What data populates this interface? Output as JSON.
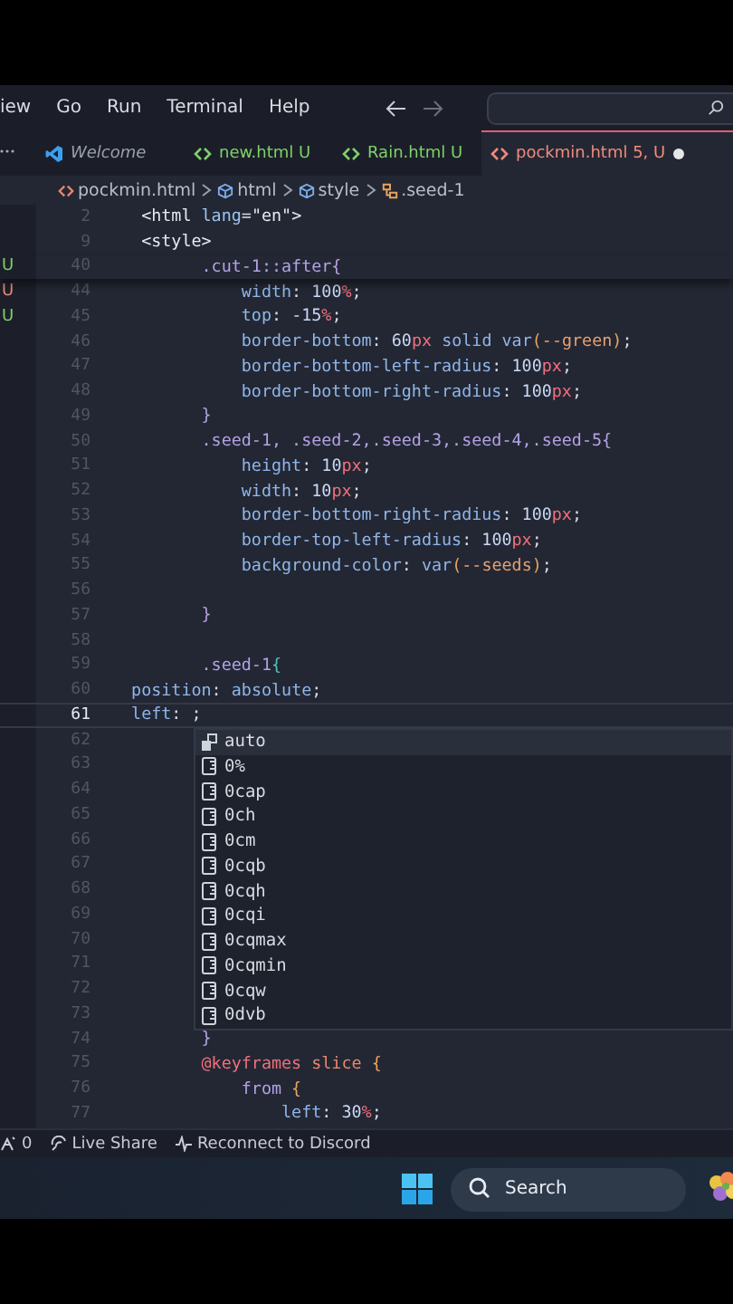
{
  "menu_bar": {
    "items": [
      "iew",
      "Go",
      "Run",
      "Terminal",
      "Help"
    ]
  },
  "tabs": [
    {
      "label": "Welcome",
      "kind": "welcome",
      "color": "#9aa0ad",
      "selected": false
    },
    {
      "label": "new.html",
      "status": "U",
      "kind": "html",
      "color": "#7fd16b",
      "selected": false
    },
    {
      "label": "Rain.html",
      "status": "U",
      "kind": "html",
      "color": "#7fd16b",
      "selected": false
    },
    {
      "label": "pockmin.html",
      "status": "5, U",
      "kind": "html",
      "color": "#f08b7e",
      "selected": true,
      "modified": true
    }
  ],
  "breadcrumb": [
    {
      "label": "pockmin.html",
      "kind": "file"
    },
    {
      "label": "html",
      "kind": "element"
    },
    {
      "label": "style",
      "kind": "element"
    },
    {
      "label": ".seed-1",
      "kind": "rule"
    }
  ],
  "editor": {
    "lines": [
      {
        "number": "2",
        "tokens": [
          {
            "kind": "tag",
            "text": "  <html"
          },
          {
            "kind": "attr",
            "text": " lang"
          },
          {
            "kind": "punct",
            "text": "="
          },
          {
            "kind": "str",
            "text": "\"en\""
          },
          {
            "kind": "tag",
            "text": ">"
          }
        ]
      },
      {
        "number": "9",
        "tokens": [
          {
            "kind": "tag",
            "text": "  <style>"
          }
        ]
      },
      {
        "number": "40",
        "sticky_end": true,
        "side_mark": {
          "text": "U",
          "color": "#7fd16b"
        },
        "tokens": [
          {
            "kind": "sel",
            "text": "        .cut-1::after"
          },
          {
            "kind": "brace",
            "text": "{"
          }
        ]
      },
      {
        "number": "44",
        "side_mark": {
          "text": "U",
          "color": "#f08b7e"
        },
        "tokens": [
          {
            "kind": "prop",
            "text": "            width"
          },
          {
            "kind": "punct",
            "text": ": "
          },
          {
            "kind": "num",
            "text": "100"
          },
          {
            "kind": "unit",
            "text": "%"
          },
          {
            "kind": "punct",
            "text": ";"
          }
        ]
      },
      {
        "number": "45",
        "side_mark": {
          "text": "U",
          "color": "#7fd16b"
        },
        "tokens": [
          {
            "kind": "prop",
            "text": "            top"
          },
          {
            "kind": "punct",
            "text": ": "
          },
          {
            "kind": "num",
            "text": "-15"
          },
          {
            "kind": "unit",
            "text": "%"
          },
          {
            "kind": "punct",
            "text": ";"
          }
        ]
      },
      {
        "number": "46",
        "tokens": [
          {
            "kind": "prop",
            "text": "            border-bottom"
          },
          {
            "kind": "punct",
            "text": ": "
          },
          {
            "kind": "num",
            "text": "60"
          },
          {
            "kind": "unit",
            "text": "px"
          },
          {
            "kind": "prop",
            "text": " solid var"
          },
          {
            "kind": "paren",
            "text": "("
          },
          {
            "kind": "var",
            "text": "--green"
          },
          {
            "kind": "paren",
            "text": ")"
          },
          {
            "kind": "punct",
            "text": ";"
          }
        ]
      },
      {
        "number": "47",
        "tokens": [
          {
            "kind": "prop",
            "text": "            border-bottom-left-radius"
          },
          {
            "kind": "punct",
            "text": ": "
          },
          {
            "kind": "num",
            "text": "100"
          },
          {
            "kind": "unit",
            "text": "px"
          },
          {
            "kind": "punct",
            "text": ";"
          }
        ]
      },
      {
        "number": "48",
        "tokens": [
          {
            "kind": "prop",
            "text": "            border-bottom-right-radius"
          },
          {
            "kind": "punct",
            "text": ": "
          },
          {
            "kind": "num",
            "text": "100"
          },
          {
            "kind": "unit",
            "text": "px"
          },
          {
            "kind": "punct",
            "text": ";"
          }
        ]
      },
      {
        "number": "49",
        "tokens": [
          {
            "kind": "brace",
            "text": "        }"
          }
        ]
      },
      {
        "number": "50",
        "tokens": [
          {
            "kind": "sel",
            "text": "        .seed-1, .seed-2,.seed-3,.seed-4,.seed-5"
          },
          {
            "kind": "brace",
            "text": "{"
          }
        ]
      },
      {
        "number": "51",
        "tokens": [
          {
            "kind": "prop",
            "text": "            height"
          },
          {
            "kind": "punct",
            "text": ": "
          },
          {
            "kind": "num",
            "text": "10"
          },
          {
            "kind": "unit",
            "text": "px"
          },
          {
            "kind": "punct",
            "text": ";"
          }
        ]
      },
      {
        "number": "52",
        "tokens": [
          {
            "kind": "prop",
            "text": "            width"
          },
          {
            "kind": "punct",
            "text": ": "
          },
          {
            "kind": "num",
            "text": "10"
          },
          {
            "kind": "unit",
            "text": "px"
          },
          {
            "kind": "punct",
            "text": ";"
          }
        ]
      },
      {
        "number": "53",
        "tokens": [
          {
            "kind": "prop",
            "text": "            border-bottom-right-radius"
          },
          {
            "kind": "punct",
            "text": ": "
          },
          {
            "kind": "num",
            "text": "100"
          },
          {
            "kind": "unit",
            "text": "px"
          },
          {
            "kind": "punct",
            "text": ";"
          }
        ]
      },
      {
        "number": "54",
        "tokens": [
          {
            "kind": "prop",
            "text": "            border-top-left-radius"
          },
          {
            "kind": "punct",
            "text": ": "
          },
          {
            "kind": "num",
            "text": "100"
          },
          {
            "kind": "unit",
            "text": "px"
          },
          {
            "kind": "punct",
            "text": ";"
          }
        ]
      },
      {
        "number": "55",
        "tokens": [
          {
            "kind": "prop",
            "text": "            background-color"
          },
          {
            "kind": "punct",
            "text": ": "
          },
          {
            "kind": "prop",
            "text": "var"
          },
          {
            "kind": "paren",
            "text": "("
          },
          {
            "kind": "var",
            "text": "--seeds"
          },
          {
            "kind": "paren",
            "text": ")"
          },
          {
            "kind": "punct",
            "text": ";"
          }
        ]
      },
      {
        "number": "56"
      },
      {
        "number": "57",
        "tokens": [
          {
            "kind": "brace",
            "text": "        }"
          }
        ]
      },
      {
        "number": "58"
      },
      {
        "number": "59",
        "tokens": [
          {
            "kind": "sel",
            "text": "        .seed-1"
          },
          {
            "kind": "match",
            "text": "{"
          }
        ]
      },
      {
        "number": "60",
        "tokens": [
          {
            "kind": "prop",
            "text": " position"
          },
          {
            "kind": "punct",
            "text": ": "
          },
          {
            "kind": "prop",
            "text": "absolute"
          },
          {
            "kind": "punct",
            "text": ";"
          }
        ]
      },
      {
        "number": "61",
        "current": true,
        "tokens": [
          {
            "kind": "prop",
            "text": " left"
          },
          {
            "kind": "punct",
            "text": ": ;"
          }
        ]
      },
      {
        "number": "62"
      },
      {
        "number": "63"
      },
      {
        "number": "64"
      },
      {
        "number": "65"
      },
      {
        "number": "66"
      },
      {
        "number": "67"
      },
      {
        "number": "68"
      },
      {
        "number": "69"
      },
      {
        "number": "70"
      },
      {
        "number": "71"
      },
      {
        "number": "72"
      },
      {
        "number": "73"
      },
      {
        "number": "74",
        "tokens": [
          {
            "kind": "brace",
            "text": "        }"
          }
        ]
      },
      {
        "number": "75",
        "tokens": [
          {
            "kind": "kw",
            "text": "        @keyframes"
          },
          {
            "kind": "name",
            "text": " slice"
          },
          {
            "kind": "paren",
            "text": " {"
          }
        ]
      },
      {
        "number": "76",
        "tokens": [
          {
            "kind": "sel",
            "text": "            from"
          },
          {
            "kind": "paren",
            "text": " {"
          }
        ]
      },
      {
        "number": "77",
        "tokens": [
          {
            "kind": "prop",
            "text": "                left"
          },
          {
            "kind": "punct",
            "text": ": "
          },
          {
            "kind": "num",
            "text": "30"
          },
          {
            "kind": "unit",
            "text": "%"
          },
          {
            "kind": "punct",
            "text": ";"
          }
        ]
      }
    ],
    "suggestions": [
      {
        "label": "auto",
        "kind": "keyword",
        "selected": true
      },
      {
        "label": "0%",
        "kind": "unit",
        "selected": false
      },
      {
        "label": "0cap",
        "kind": "unit",
        "selected": false
      },
      {
        "label": "0ch",
        "kind": "unit",
        "selected": false
      },
      {
        "label": "0cm",
        "kind": "unit",
        "selected": false
      },
      {
        "label": "0cqb",
        "kind": "unit",
        "selected": false
      },
      {
        "label": "0cqh",
        "kind": "unit",
        "selected": false
      },
      {
        "label": "0cqi",
        "kind": "unit",
        "selected": false
      },
      {
        "label": "0cqmax",
        "kind": "unit",
        "selected": false
      },
      {
        "label": "0cqmin",
        "kind": "unit",
        "selected": false
      },
      {
        "label": "0cqw",
        "kind": "unit",
        "selected": false
      },
      {
        "label": "0dvb",
        "kind": "unit",
        "selected": false
      }
    ]
  },
  "status_bar": [
    {
      "label": "0",
      "kind": "ports"
    },
    {
      "label": "Live Share",
      "kind": "liveshare"
    },
    {
      "label": "Reconnect to Discord",
      "kind": "discord"
    }
  ],
  "taskbar": {
    "search": {
      "placeholder": "Search"
    }
  }
}
